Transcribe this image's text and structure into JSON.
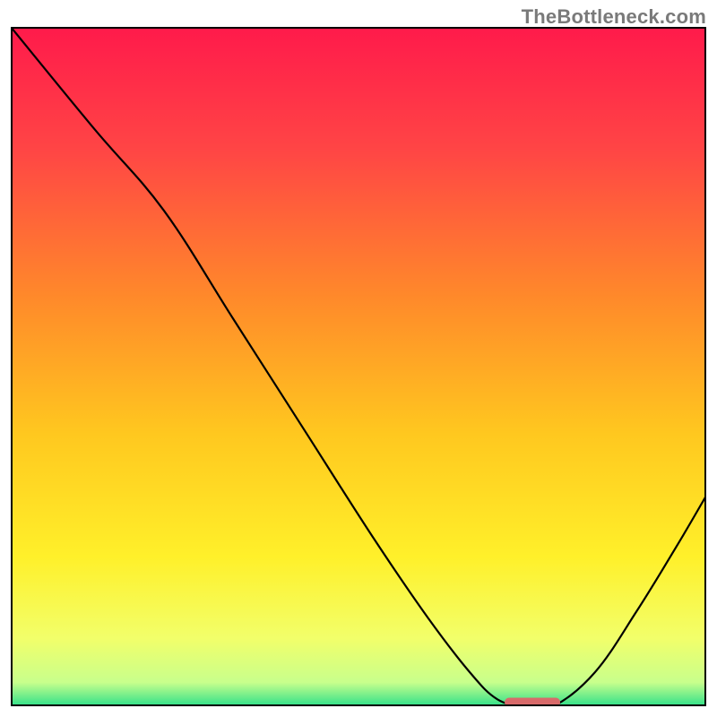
{
  "watermark": "TheBottleneck.com",
  "chart_data": {
    "type": "line",
    "title": "",
    "xlabel": "",
    "ylabel": "",
    "xlim": [
      0,
      100
    ],
    "ylim": [
      0,
      100
    ],
    "grid": false,
    "legend": false,
    "series": [
      {
        "name": "curve",
        "x": [
          0,
          12,
          22,
          32,
          42,
          52,
          60,
          66,
          70,
          74,
          78,
          84,
          90,
          96,
          100
        ],
        "bottleneck_pct": [
          100,
          85,
          73,
          57,
          41,
          25,
          13,
          5,
          1,
          0,
          0,
          5,
          14,
          24,
          31
        ]
      }
    ],
    "marker": {
      "name": "optimal-range",
      "x_range": [
        71,
        79
      ],
      "y": 0.6,
      "color": "#d86a6a"
    },
    "background_gradient": {
      "stops": [
        {
          "pos": 0.0,
          "color": "#ff1a4b"
        },
        {
          "pos": 0.18,
          "color": "#ff4545"
        },
        {
          "pos": 0.4,
          "color": "#ff8a2a"
        },
        {
          "pos": 0.6,
          "color": "#ffc81f"
        },
        {
          "pos": 0.78,
          "color": "#fff02a"
        },
        {
          "pos": 0.9,
          "color": "#f2ff6a"
        },
        {
          "pos": 0.965,
          "color": "#c8ff8c"
        },
        {
          "pos": 1.0,
          "color": "#2fe08a"
        }
      ]
    }
  }
}
